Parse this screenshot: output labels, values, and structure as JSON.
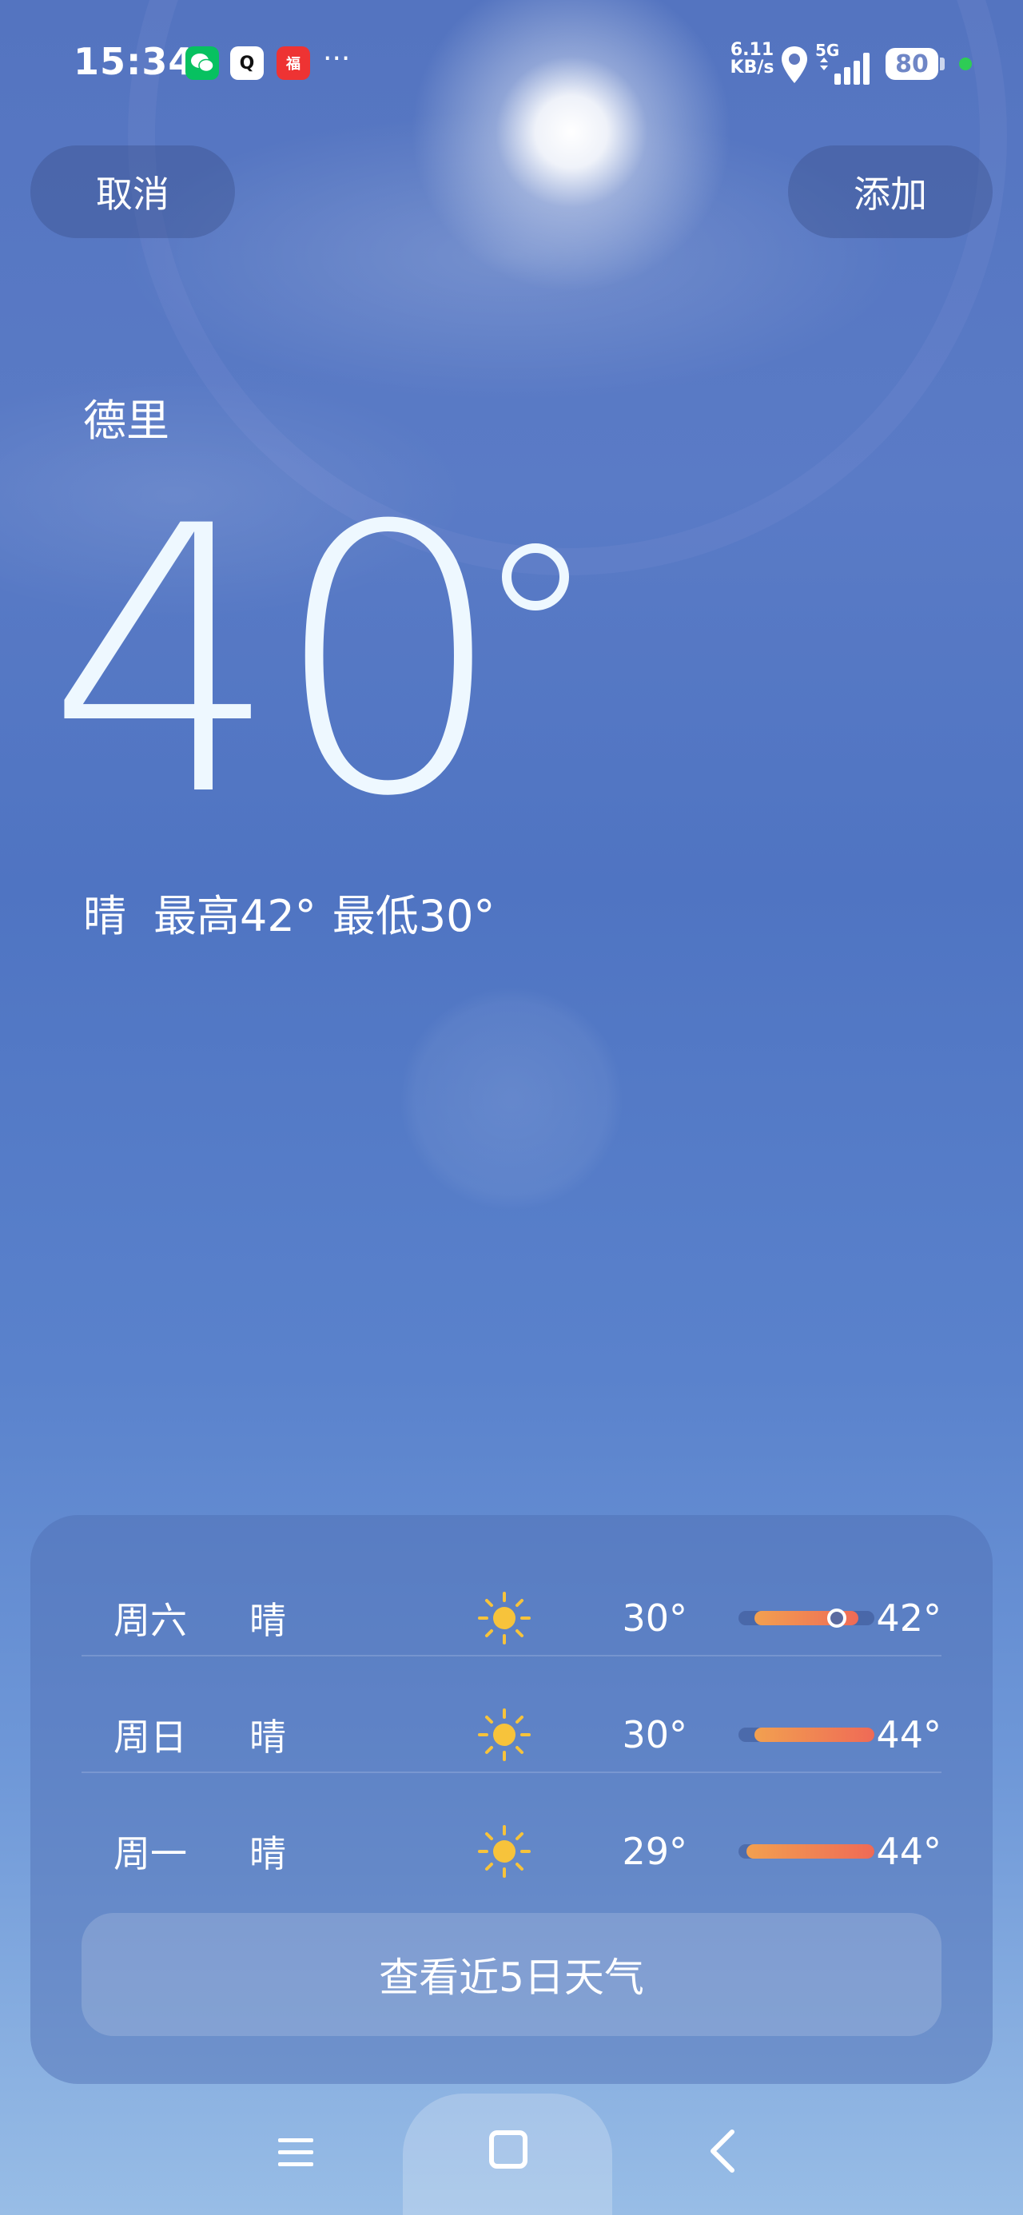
{
  "status_bar": {
    "time": "15:34",
    "apps": [
      "wechat-icon",
      "qq-icon",
      "app-icon"
    ],
    "qq_glyph": "Q",
    "app3_glyph": "福",
    "more": "···",
    "net_speed_value": "6.11",
    "net_speed_unit": "KB/s",
    "network": "5G",
    "battery": "80"
  },
  "header": {
    "cancel_label": "取消",
    "add_label": "添加"
  },
  "weather": {
    "city": "德里",
    "temperature": "40",
    "condition": "晴",
    "high_label": "最高42°",
    "low_label": "最低30°"
  },
  "forecast": [
    {
      "day": "周六",
      "condition": "晴",
      "icon": "sun-icon",
      "low": "30°",
      "high": "42°",
      "bar_start": 0.12,
      "bar_end": 0.88,
      "current": 0.7
    },
    {
      "day": "周日",
      "condition": "晴",
      "icon": "sun-icon",
      "low": "30°",
      "high": "44°",
      "bar_start": 0.12,
      "bar_end": 1.0
    },
    {
      "day": "周一",
      "condition": "晴",
      "icon": "sun-icon",
      "low": "29°",
      "high": "44°",
      "bar_start": 0.06,
      "bar_end": 1.0
    }
  ],
  "five_day_button": "查看近5日天气",
  "nav": [
    "menu-icon",
    "home-icon",
    "back-icon"
  ],
  "colors": {
    "bar_start": "#f2a050",
    "bar_end": "#ef6a56",
    "sun": "#f7c33b"
  }
}
